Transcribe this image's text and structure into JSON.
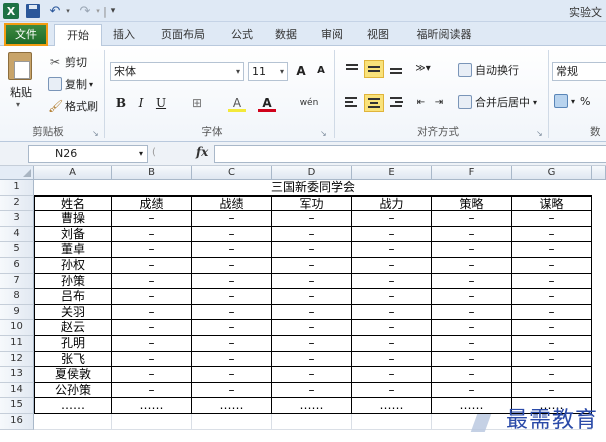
{
  "window": {
    "title": "实验文"
  },
  "quick_access": {
    "app_icon": "X",
    "undo": "↶",
    "redo": "↷",
    "dropdown": "▾",
    "separator": "|",
    "customize": "▾"
  },
  "tabs": {
    "file": "文件",
    "home": "开始",
    "insert": "插入",
    "layout": "页面布局",
    "formula": "公式",
    "data": "数据",
    "review": "审阅",
    "view": "视图",
    "reader": "福昕阅读器"
  },
  "ribbon": {
    "clipboard": {
      "paste": "粘贴",
      "cut": "剪切",
      "copy": "复制",
      "format_painter": "格式刷",
      "label": "剪贴板"
    },
    "font": {
      "name": "宋体",
      "size": "11",
      "grow": "A",
      "shrink": "A",
      "bold": "B",
      "italic": "I",
      "underline": "U",
      "border": "⊞",
      "fill": "A",
      "color": "A",
      "wen": "wén",
      "label": "字体"
    },
    "alignment": {
      "wrap": "自动换行",
      "merge": "合并后居中",
      "label": "对齐方式"
    },
    "number": {
      "format": "常规",
      "percent": "%",
      "label": "数"
    }
  },
  "formula_bar": {
    "name_box": "N26",
    "fx": "fx",
    "value": ""
  },
  "sheet": {
    "col_headers": [
      "A",
      "B",
      "C",
      "D",
      "E",
      "F",
      "G"
    ],
    "row_headers": [
      "1",
      "2",
      "3",
      "4",
      "5",
      "6",
      "7",
      "8",
      "9",
      "10",
      "11",
      "12",
      "13",
      "14",
      "15",
      "16"
    ],
    "title": "三国新委同学会",
    "headers": [
      "姓名",
      "成绩",
      "战绩",
      "军功",
      "战力",
      "策略",
      "谋略"
    ],
    "rows": [
      [
        "曹操",
        "–",
        "–",
        "–",
        "–",
        "–",
        "–"
      ],
      [
        "刘备",
        "–",
        "–",
        "–",
        "–",
        "–",
        "–"
      ],
      [
        "董卓",
        "–",
        "–",
        "–",
        "–",
        "–",
        "–"
      ],
      [
        "孙权",
        "–",
        "–",
        "–",
        "–",
        "–",
        "–"
      ],
      [
        "孙策",
        "–",
        "–",
        "–",
        "–",
        "–",
        "–"
      ],
      [
        "吕布",
        "–",
        "–",
        "–",
        "–",
        "–",
        "–"
      ],
      [
        "关羽",
        "–",
        "–",
        "–",
        "–",
        "–",
        "–"
      ],
      [
        "赵云",
        "–",
        "–",
        "–",
        "–",
        "–",
        "–"
      ],
      [
        "孔明",
        "–",
        "–",
        "–",
        "–",
        "–",
        "–"
      ],
      [
        "张飞",
        "–",
        "–",
        "–",
        "–",
        "–",
        "–"
      ],
      [
        "夏侯敦",
        "–",
        "–",
        "–",
        "–",
        "–",
        "–"
      ],
      [
        "公孙策",
        "–",
        "–",
        "–",
        "–",
        "–",
        "–"
      ],
      [
        "……",
        "……",
        "……",
        "……",
        "……",
        "……",
        "……"
      ]
    ]
  },
  "watermark": "最需教育",
  "colors": {
    "file_tab": "#2e7d32",
    "file_border": "#f39c12",
    "ribbon_bg": "#dfe9f5",
    "highlight": "#f9e27a",
    "watermark": "#2a4aa8"
  }
}
